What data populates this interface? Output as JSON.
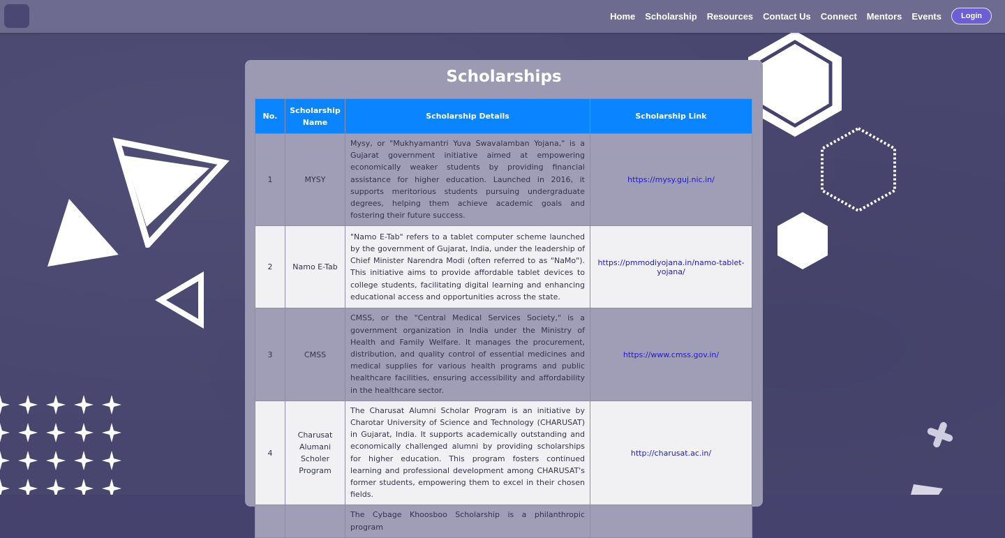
{
  "nav": {
    "links": [
      "Home",
      "Scholarship",
      "Resources",
      "Contact Us",
      "Connect",
      "Mentors",
      "Events"
    ],
    "login_label": "Login"
  },
  "page": {
    "title": "Scholarships"
  },
  "table": {
    "headers": {
      "no": "No.",
      "name": "Scholarship Name",
      "details": "Scholarship Details",
      "link": "Scholarship Link"
    },
    "rows": [
      {
        "no": "1",
        "name": "MYSY",
        "details": "Mysy, or \"Mukhyamantri Yuva Swavalamban Yojana,\" is a Gujarat government initiative aimed at empowering economically weaker students by providing financial assistance for higher education. Launched in 2016, it supports meritorious students pursuing undergraduate degrees, helping them achieve academic goals and fostering their future success.",
        "link": "https://mysy.guj.nic.in/"
      },
      {
        "no": "2",
        "name": "Namo E-Tab",
        "details": "\"Namo E-Tab\" refers to a tablet computer scheme launched by the government of Gujarat, India, under the leadership of Chief Minister Narendra Modi (often referred to as \"NaMo\"). This initiative aims to provide affordable tablet devices to college students, facilitating digital learning and enhancing educational access and opportunities across the state.",
        "link": "https://pmmodiyojana.in/namo-tablet-yojana/"
      },
      {
        "no": "3",
        "name": "CMSS",
        "details": "CMSS, or the \"Central Medical Services Society,\" is a government organization in India under the Ministry of Health and Family Welfare. It manages the procurement, distribution, and quality control of essential medicines and medical supplies for various health programs and public healthcare facilities, ensuring accessibility and affordability in the healthcare sector.",
        "link": "https://www.cmss.gov.in/"
      },
      {
        "no": "4",
        "name": "Charusat Alumani Scholer Program",
        "details": "The Charusat Alumni Scholar Program is an initiative by Charotar University of Science and Technology (CHARUSAT) in Gujarat, India. It supports academically outstanding and economically challenged alumni by providing scholarships for higher education. This program fosters continued learning and professional development among CHARUSAT's former students, empowering them to excel in their chosen fields.",
        "link": "http://charusat.ac.in/"
      },
      {
        "no": "",
        "name": "",
        "details": "The Cybage Khoosboo Scholarship is a philanthropic program",
        "link": ""
      }
    ]
  }
}
